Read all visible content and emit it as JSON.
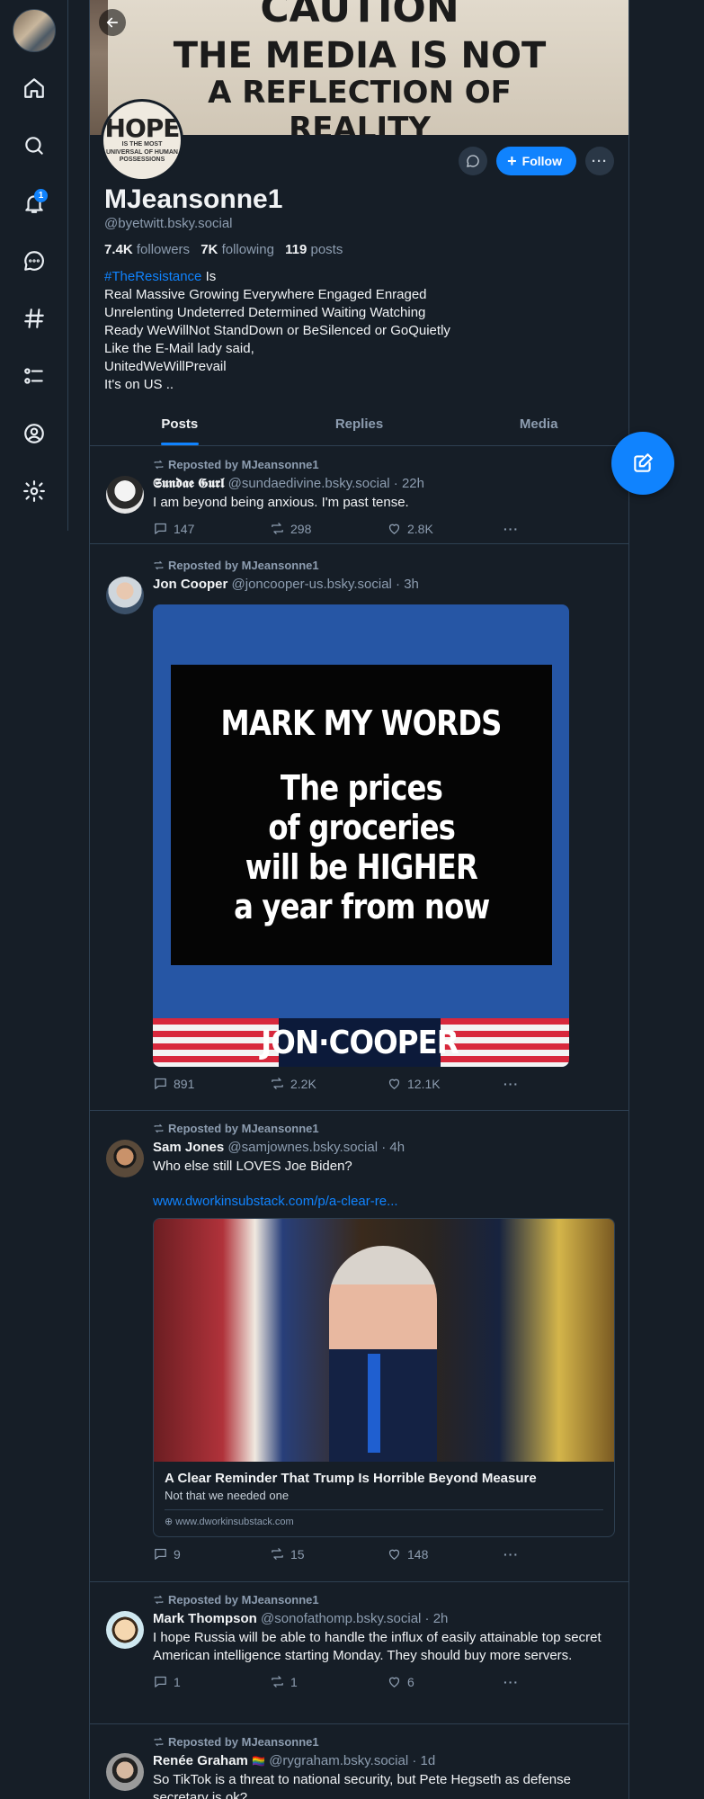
{
  "nav": {
    "notifications_badge": "1",
    "items": [
      "home",
      "search",
      "notifications",
      "chat",
      "feeds",
      "lists",
      "profile",
      "settings"
    ]
  },
  "banner": {
    "line1": "CAUTION",
    "line2": "THE MEDIA IS NOT",
    "line3": "A REFLECTION OF",
    "line4": "REALITY"
  },
  "avatar": {
    "big": "HOPE",
    "sub1": "IS THE MOST",
    "sub2": "UNIVERSAL OF HUMAN",
    "sub3": "POSSESSIONS"
  },
  "profile": {
    "display_name": "MJeansonne1",
    "handle": "@byetwitt.bsky.social",
    "followers_count": "7.4K",
    "followers_label": "followers",
    "following_count": "7K",
    "following_label": "following",
    "posts_count": "119",
    "posts_label": "posts",
    "follow_label": "Follow",
    "bio_tag": "#TheResistance",
    "bio_line1_rest": " Is",
    "bio_lines": [
      "Real Massive Growing Everywhere Engaged Enraged",
      "Unrelenting Undeterred Determined Waiting Watching",
      "Ready WeWillNot StandDown or BeSilenced or GoQuietly",
      "Like the E-Mail lady said,",
      "UnitedWeWillPrevail",
      "It's on US .."
    ]
  },
  "tabs": [
    "Posts",
    "Replies",
    "Media"
  ],
  "feed": [
    {
      "repost_label": "Reposted by MJeansonne1",
      "name": "𝕾𝖚𝖓𝖉𝖆𝖊 𝕲𝖚𝖗𝖑",
      "meta": "@sundaedivine.bsky.social · 22h",
      "text": "I am beyond being anxious. I'm past tense.",
      "replies": "147",
      "reposts": "298",
      "likes": "2.8K"
    },
    {
      "repost_label": "Reposted by MJeansonne1",
      "name": "Jon Cooper",
      "meta": "@joncooper-us.bsky.social · 3h",
      "image_title": "MARK MY WORDS",
      "image_lines": [
        "The prices",
        "of groceries",
        "will be HIGHER",
        "a year from now"
      ],
      "image_footer": "JON·COOPER",
      "replies": "891",
      "reposts": "2.2K",
      "likes": "12.1K"
    },
    {
      "repost_label": "Reposted by MJeansonne1",
      "name": "Sam Jones",
      "meta": "@samjownes.bsky.social · 4h",
      "text": "Who else still LOVES Joe Biden?",
      "link": "www.dworkinsubstack.com/p/a-clear-re...",
      "card_title": "A Clear Reminder That Trump Is Horrible Beyond Measure",
      "card_desc": "Not that we needed one",
      "card_domain": "www.dworkinsubstack.com",
      "replies": "9",
      "reposts": "15",
      "likes": "148"
    },
    {
      "repost_label": "Reposted by MJeansonne1",
      "name": "Mark Thompson",
      "meta": "@sonofathomp.bsky.social · 2h",
      "text": "I hope Russia will be able to handle the influx of easily attainable top secret American intelligence starting Monday. They should buy more servers.",
      "replies": "1",
      "reposts": "1",
      "likes": "6"
    },
    {
      "repost_label": "Reposted by MJeansonne1",
      "name": "Renée Graham",
      "name_emoji": "🏳️‍🌈",
      "meta": "@rygraham.bsky.social · 1d",
      "text": "So TikTok is a threat to national security, but Pete Hegseth as defense secretary is ok?"
    }
  ],
  "colors": {
    "background": "#161e27",
    "accent": "#1083fe",
    "muted_text": "#8d9db0",
    "border": "#2e4052"
  }
}
